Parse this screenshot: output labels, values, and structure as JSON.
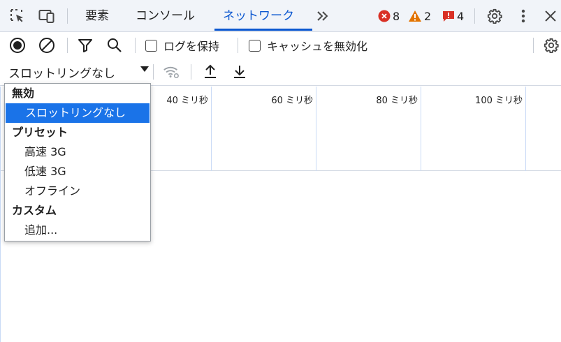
{
  "tabbar": {
    "tabs": [
      {
        "label": "要素"
      },
      {
        "label": "コンソール"
      },
      {
        "label": "ネットワーク"
      }
    ],
    "errors_count": "8",
    "warnings_count": "2",
    "issues_count": "4",
    "accent_color": "#0b57d0",
    "error_color": "#d93025",
    "warning_color": "#e37400",
    "issue_color": "#d93025"
  },
  "toolbar": {
    "preserve_log_label": "ログを保持",
    "disable_cache_label": "キャッシュを無効化",
    "throttle_value": "スロットリングなし"
  },
  "overview": {
    "ticks": [
      "40 ミリ秒",
      "60 ミリ秒",
      "80 ミリ秒",
      "100 ミリ秒"
    ]
  },
  "dropdown": {
    "items": [
      {
        "type": "group",
        "label": "無効"
      },
      {
        "type": "option",
        "label": "スロットリングなし",
        "selected": true
      },
      {
        "type": "group",
        "label": "プリセット"
      },
      {
        "type": "option",
        "label": "高速 3G"
      },
      {
        "type": "option",
        "label": "低速 3G"
      },
      {
        "type": "option",
        "label": "オフライン"
      },
      {
        "type": "group",
        "label": "カスタム"
      },
      {
        "type": "option",
        "label": "追加..."
      }
    ]
  }
}
